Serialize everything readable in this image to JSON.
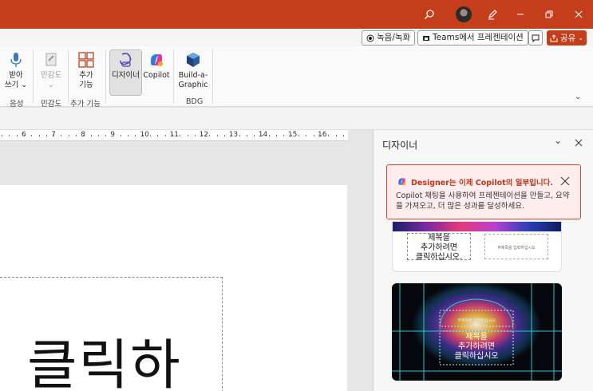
{
  "titlebar": {
    "icons": [
      "search-icon",
      "avatar",
      "pen-icon",
      "minimize-icon",
      "restore-icon",
      "close-icon"
    ]
  },
  "commands": {
    "record_label": "녹음/녹화",
    "teams_label": "Teams에서 프레젠테이션",
    "share_label": "공유"
  },
  "ribbon": {
    "dictate": {
      "label1": "받아",
      "label2": "쓰기 ⌄"
    },
    "sensitivity": {
      "label1": "민감도",
      "label2": "⌄"
    },
    "addins": {
      "label1": "추가",
      "label2": "기능"
    },
    "designer": {
      "label": "디자이너"
    },
    "copilot": {
      "label": "Copilot"
    },
    "build": {
      "label1": "Build-a-",
      "label2": "Graphic"
    },
    "groups": {
      "voice": "음성",
      "sensitivity": "민감도",
      "addins": "추가 기능",
      "bdg": "BDG"
    }
  },
  "ruler": {
    "ticks": [
      "6",
      "7",
      "8",
      "9",
      "10",
      "11",
      "12",
      "13",
      "14",
      "15",
      "16"
    ]
  },
  "slide": {
    "big_text": "클릭하"
  },
  "designer_pane": {
    "title": "디자이너",
    "notice_title": "Designer는 이제 Copilot의 일부입니다.",
    "notice_body": "Copilot 채팅을 사용하여 프레젠테이션을 만들고, 요약을 가져오고, 더 많은 성과를 달성하세요.",
    "card1": {
      "title_text": "제목을\n추가하려면\n클릭하십시오.",
      "subtitle_text": "부제목을 입력하십시오"
    },
    "card2": {
      "top_text": "부제목을 입력하십시오",
      "title_text": "제목을\n추가하려면\n클릭하십시오"
    }
  },
  "colors": {
    "accent": "#c43e1c",
    "notice_border": "#d9462f",
    "notice_text": "#c0341d"
  }
}
